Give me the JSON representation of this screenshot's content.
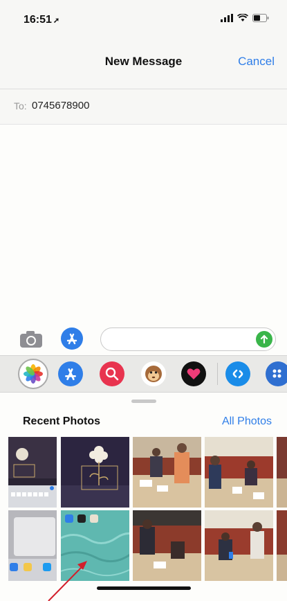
{
  "status": {
    "time": "16:51",
    "location_icon": "location-arrow-icon",
    "icons": [
      "signal-icon",
      "wifi-icon",
      "battery-icon"
    ]
  },
  "header": {
    "title": "New Message",
    "cancel_label": "Cancel"
  },
  "recipient": {
    "label": "To:",
    "value": "0745678900"
  },
  "composer": {
    "placeholder": "",
    "value": ""
  },
  "app_drawer": {
    "apps": [
      "photos-app-icon",
      "app-store-icon",
      "image-search-icon",
      "animoji-icon",
      "digital-touch-icon",
      "shazam-icon",
      "more-apps-icon"
    ]
  },
  "photos": {
    "section_title": "Recent Photos",
    "all_photos_label": "All Photos",
    "thumbnails": [
      {
        "name": "photo-phone-screenshot-keyboard"
      },
      {
        "name": "photo-cushion-flower"
      },
      {
        "name": "photo-workshop-people-1"
      },
      {
        "name": "photo-workshop-people-2"
      },
      {
        "name": "photo-app-switcher"
      },
      {
        "name": "photo-water-background"
      },
      {
        "name": "photo-workshop-people-3"
      },
      {
        "name": "photo-workshop-people-4"
      }
    ]
  },
  "colors": {
    "accent": "#2f7ee8",
    "send": "#3ab54a",
    "annotation": "#d21f2b"
  }
}
